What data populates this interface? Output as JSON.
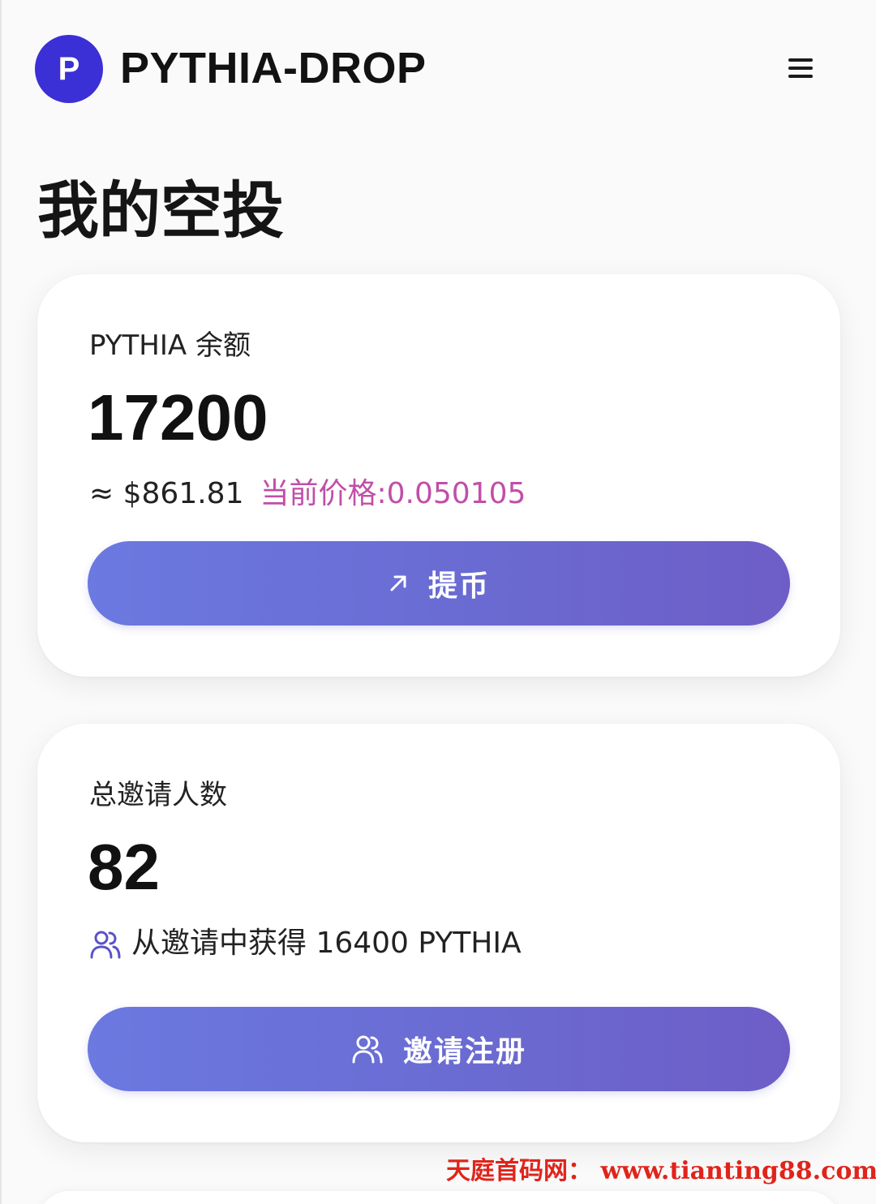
{
  "header": {
    "logo_letter": "P",
    "brand": "PYTHIA-DROP",
    "menu_icon": "hamburger-menu-icon"
  },
  "page_title": "我的空投",
  "balance_card": {
    "label": "PYTHIA 余额",
    "value": "17200",
    "usd": "≈ $861.81",
    "price": "当前价格:0.050105",
    "withdraw_button": "提币",
    "withdraw_icon": "arrow-up-right-icon"
  },
  "invite_card": {
    "label": "总邀请人数",
    "value": "82",
    "earned": "从邀请中获得 16400 PYTHIA",
    "earned_icon": "users-icon",
    "invite_button": "邀请注册",
    "invite_icon": "users-icon"
  },
  "watermark": "天庭首码网：  www.tianting88.com",
  "colors": {
    "logo": "#3b2fd6",
    "button_gradient_start": "#6b79e0",
    "button_gradient_end": "#6e5dc7",
    "price_text": "#c04fa8",
    "icon_accent": "#5a52c8",
    "watermark": "#e0241b"
  }
}
